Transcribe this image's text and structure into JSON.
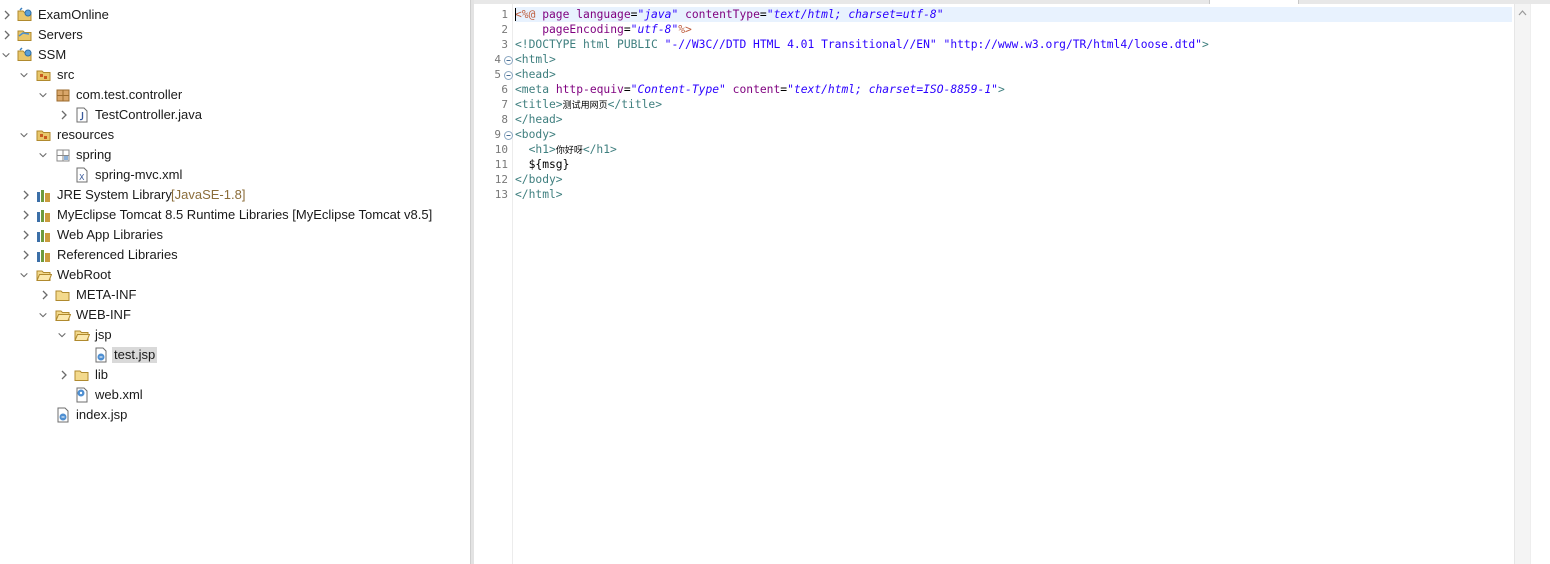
{
  "explorer": {
    "items": [
      {
        "label": "ExamOnline",
        "icon": "project-icon",
        "expanded": false
      },
      {
        "label": "Servers",
        "icon": "servers-folder-icon",
        "expanded": false
      },
      {
        "label": "SSM",
        "icon": "project-icon",
        "expanded": true
      },
      {
        "label": "src",
        "icon": "source-folder-icon",
        "expanded": true
      },
      {
        "label": "com.test.controller",
        "icon": "package-icon",
        "expanded": true
      },
      {
        "label": "TestController.java",
        "icon": "java-file-icon",
        "expanded": false
      },
      {
        "label": "resources",
        "icon": "source-folder-icon",
        "expanded": true
      },
      {
        "label": "spring",
        "icon": "package-icon",
        "expanded": true
      },
      {
        "label": "spring-mvc.xml",
        "icon": "xml-file-icon"
      },
      {
        "label": "JRE System Library",
        "decoration": "[JavaSE-1.8]",
        "icon": "library-icon",
        "expanded": false
      },
      {
        "label": "MyEclipse Tomcat 8.5 Runtime Libraries [MyEclipse Tomcat v8.5]",
        "icon": "library-icon",
        "expanded": false
      },
      {
        "label": "Web App Libraries",
        "icon": "library-icon",
        "expanded": false
      },
      {
        "label": "Referenced Libraries",
        "icon": "library-icon",
        "expanded": false
      },
      {
        "label": "WebRoot",
        "icon": "folder-icon",
        "expanded": true
      },
      {
        "label": "META-INF",
        "icon": "folder-icon",
        "expanded": false
      },
      {
        "label": "WEB-INF",
        "icon": "folder-icon",
        "expanded": true
      },
      {
        "label": "jsp",
        "icon": "folder-icon",
        "expanded": true
      },
      {
        "label": "test.jsp",
        "icon": "jsp-file-icon",
        "selected": true
      },
      {
        "label": "lib",
        "icon": "folder-icon",
        "expanded": false
      },
      {
        "label": "web.xml",
        "icon": "web-xml-icon"
      },
      {
        "label": "index.jsp",
        "icon": "jsp-file-icon"
      }
    ]
  },
  "editor": {
    "line_numbers": [
      "1",
      "2",
      "3",
      "4",
      "5",
      "6",
      "7",
      "8",
      "9",
      "10",
      "11",
      "12",
      "13"
    ],
    "lines": {
      "l1": {
        "a": "<%@",
        "b": " page ",
        "c": "language",
        "d": "=",
        "e": "\"java\"",
        "f": " contentType",
        "g": "=",
        "h": "\"text/html; charset=utf-8\""
      },
      "l2": {
        "a": "    pageEncoding",
        "b": "=",
        "c": "\"utf-8\"",
        "d": "%>"
      },
      "l3": {
        "a": "<!DOCTYPE html PUBLIC ",
        "b": "\"-//W3C//DTD HTML 4.01 Transitional//EN\"",
        "c": " ",
        "d": "\"http://www.w3.org/TR/html4/loose.dtd\"",
        "e": ">"
      },
      "l4": {
        "a": "<html>"
      },
      "l5": {
        "a": "<head>"
      },
      "l6": {
        "a": "<meta ",
        "b": "http-equiv",
        "c": "=",
        "d": "\"Content-Type\"",
        "e": " content",
        "f": "=",
        "g": "\"text/html; charset=ISO-8859-1\"",
        "h": ">"
      },
      "l7": {
        "a": "<title>",
        "b": "测试用网页",
        "c": "</title>"
      },
      "l8": {
        "a": "</head>"
      },
      "l9": {
        "a": "<body>"
      },
      "l10": {
        "a": "  <h1>",
        "b": "你好呀",
        "c": "</h1>"
      },
      "l11": {
        "a": "  ${msg}"
      },
      "l12": {
        "a": "</body>"
      },
      "l13": {
        "a": "</html>"
      }
    }
  },
  "colors": {
    "tag": "#3f7f7f",
    "attribute": "#7f007f",
    "value": "#2a00ff",
    "directive": "#bf5f3f",
    "current_line": "#e8f2fe",
    "selection": "#d9d9d9"
  }
}
